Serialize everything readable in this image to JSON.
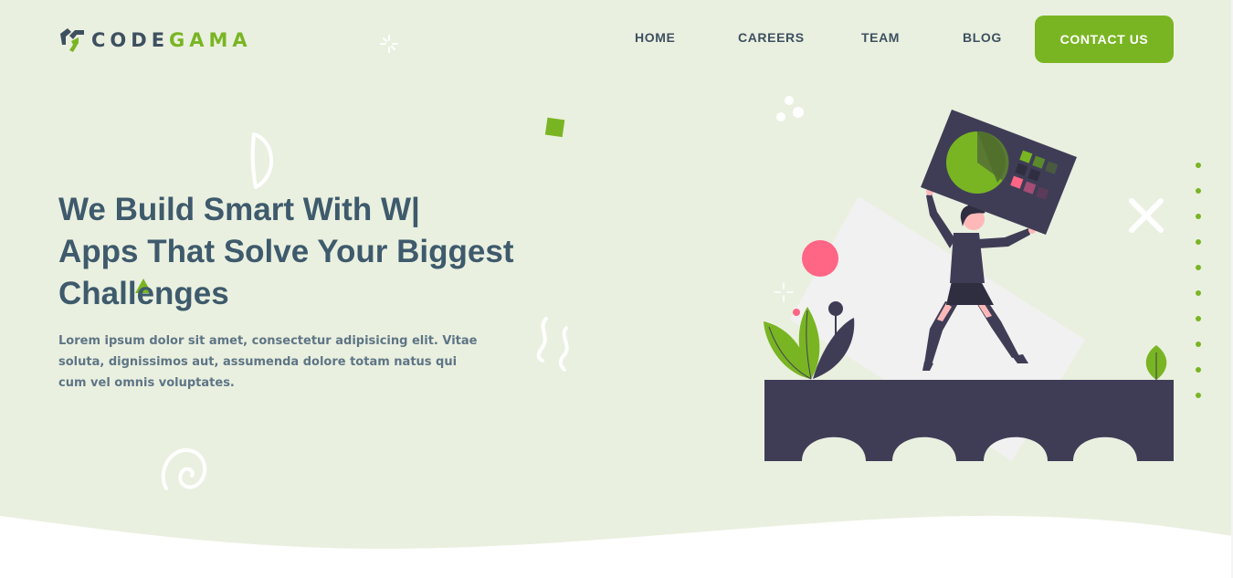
{
  "brand": {
    "logo_text_part1": "CODE",
    "logo_text_part2": "GAMA",
    "logo_icon": "codegama-logo-icon"
  },
  "nav": {
    "items": [
      {
        "label": "HOME"
      },
      {
        "label": "CAREERS"
      },
      {
        "label": "TEAM"
      },
      {
        "label": "BLOG"
      }
    ],
    "cta_label": "CONTACT US"
  },
  "hero": {
    "headline_line1": "We Build Smart With  W|",
    "headline_line2": "Apps That Solve Your Biggest",
    "headline_line3": "Challenges",
    "subtext": "Lorem ipsum dolor sit amet, consectetur adipisicing elit. Vitae soluta, dignissimos aut, assumenda dolore totam natus qui cum vel omnis voluptates."
  },
  "colors": {
    "accent": "#79b523",
    "background": "#eaf0e0",
    "heading": "#3e5a6c",
    "dark": "#3f3d56",
    "pink": "#ff6584"
  },
  "icons": {
    "hero_illustration": "woman-holding-chart-illustration"
  }
}
